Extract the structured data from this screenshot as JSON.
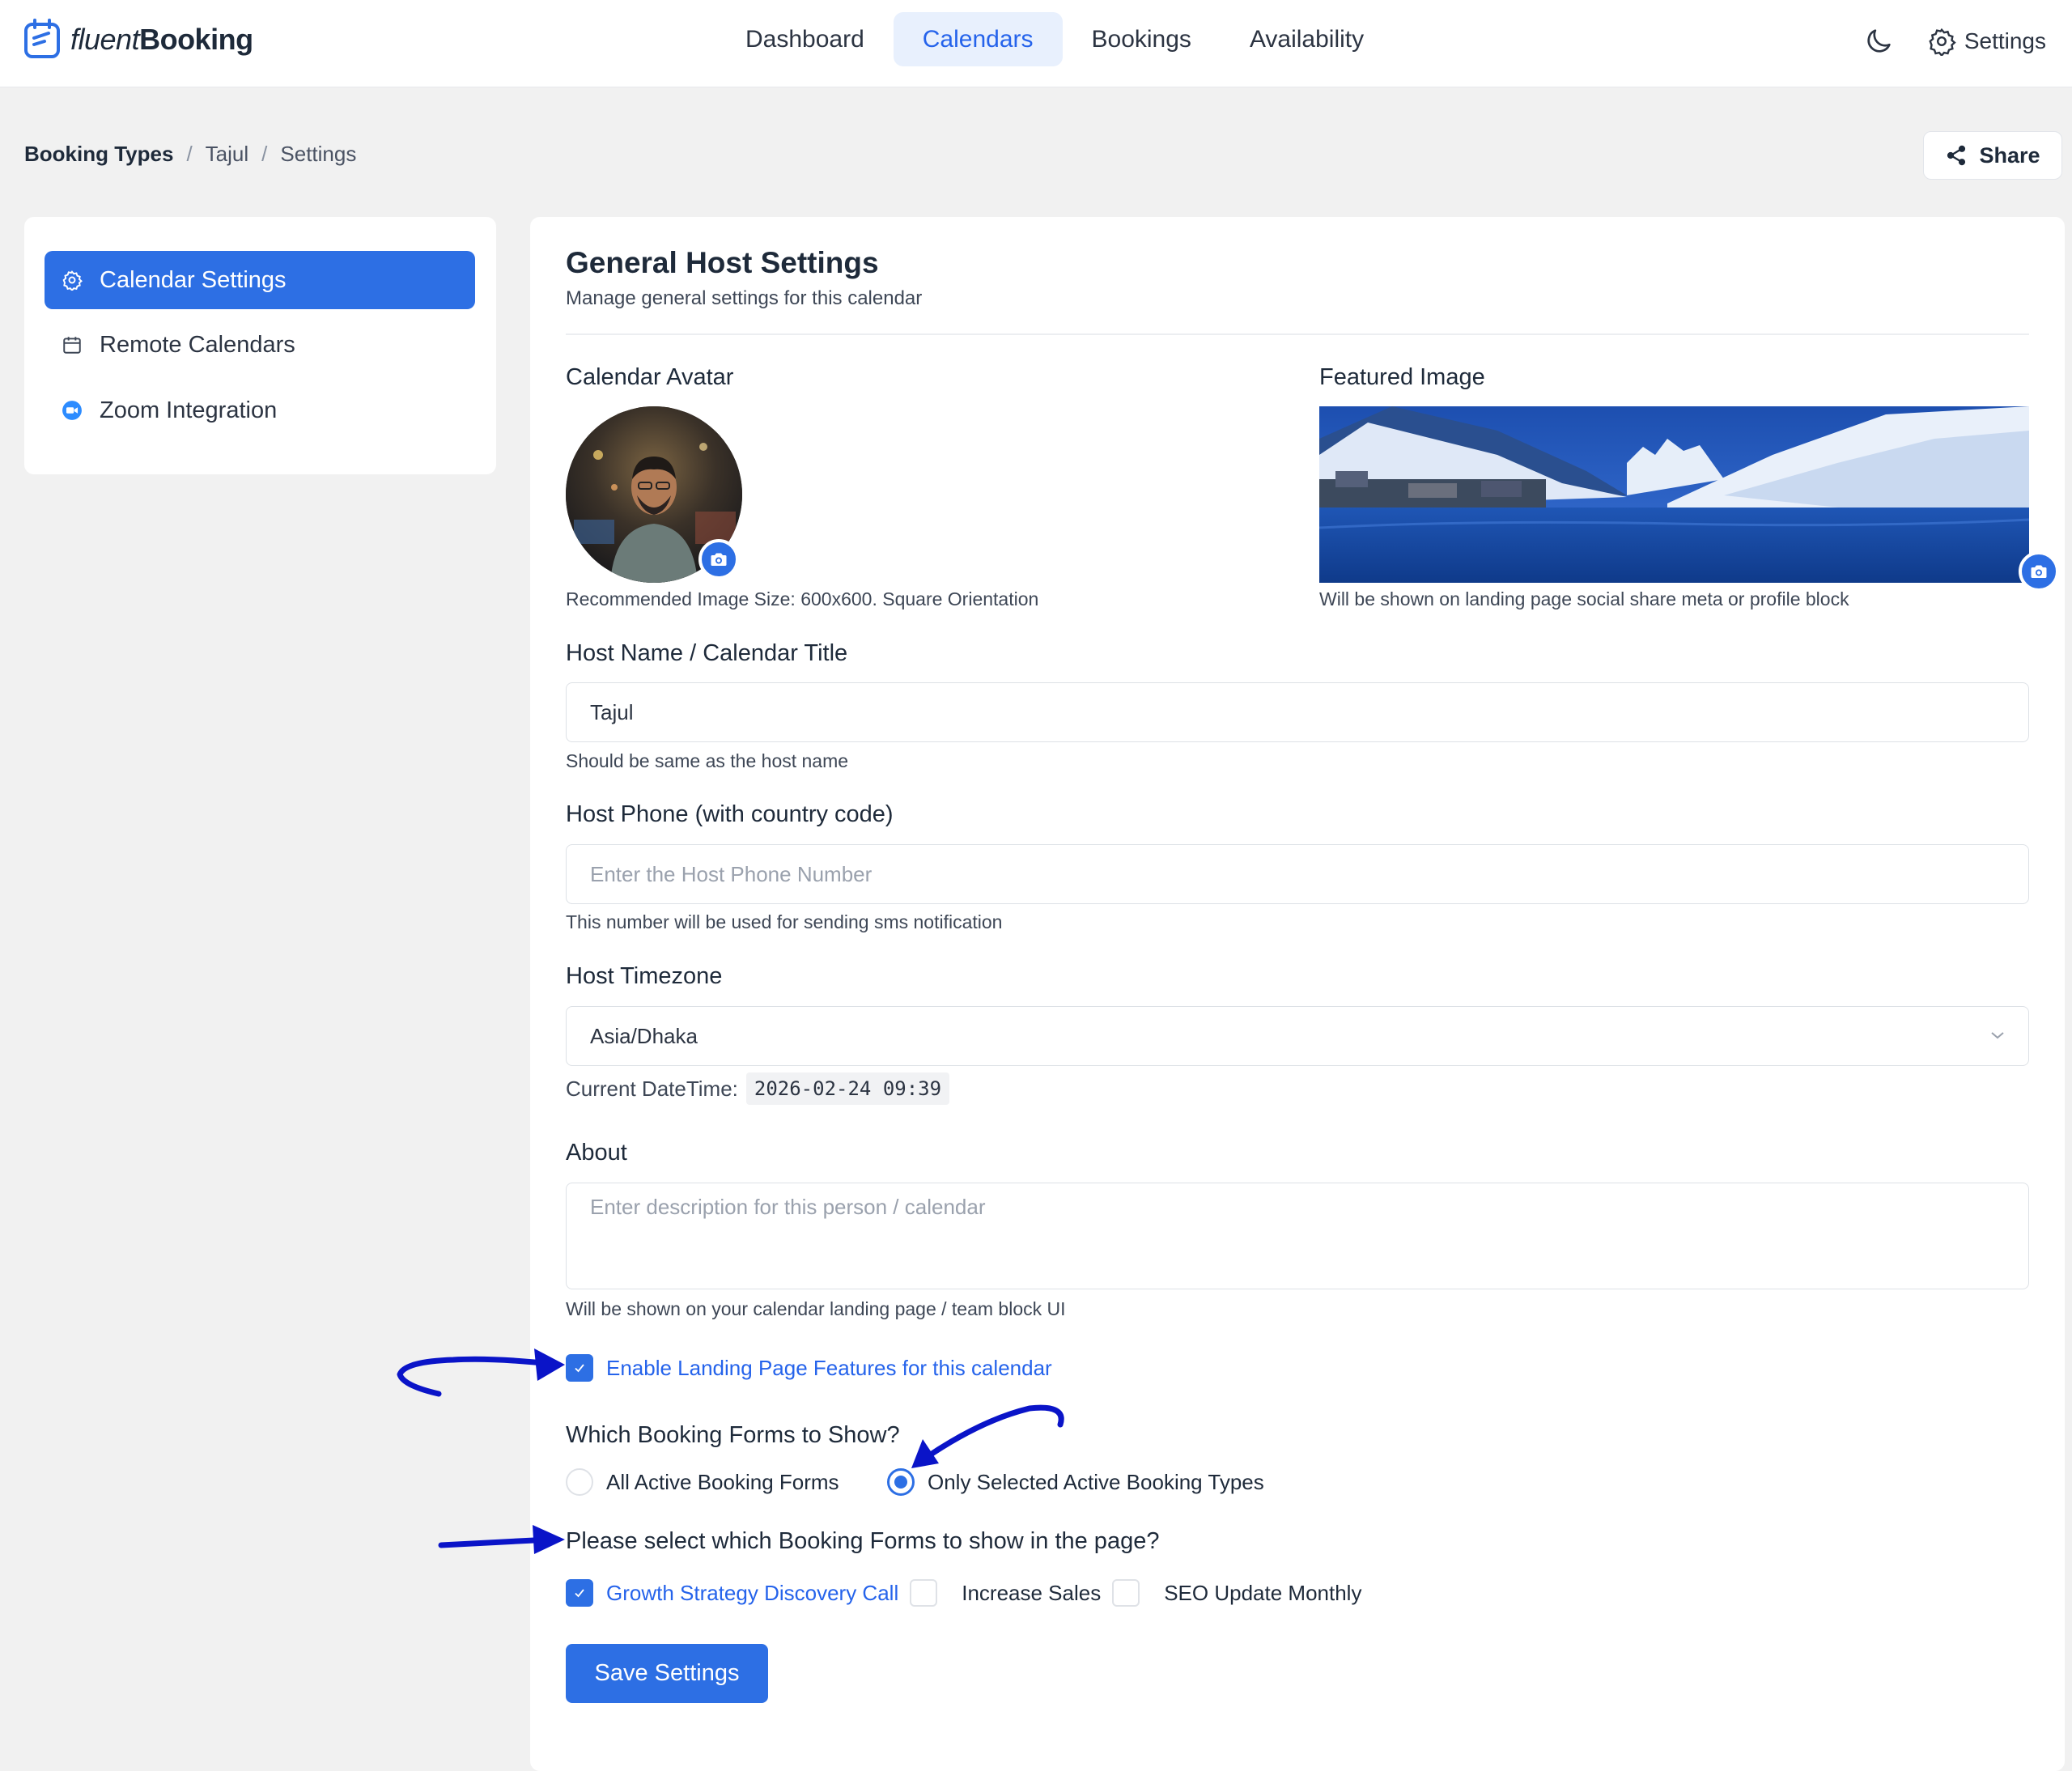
{
  "brand": {
    "name_light": "fluent",
    "name_bold": "Booking",
    "accent": "#2d6fe4"
  },
  "nav": {
    "items": [
      {
        "label": "Dashboard",
        "active": false
      },
      {
        "label": "Calendars",
        "active": true
      },
      {
        "label": "Bookings",
        "active": false
      },
      {
        "label": "Availability",
        "active": false
      }
    ],
    "settings_label": "Settings"
  },
  "breadcrumb": {
    "root": "Booking Types",
    "item1": "Tajul",
    "item2": "Settings"
  },
  "share_label": "Share",
  "sidebar": {
    "items": [
      {
        "label": "Calendar Settings",
        "icon": "gear-icon",
        "active": true
      },
      {
        "label": "Remote Calendars",
        "icon": "calendar-icon",
        "active": false
      },
      {
        "label": "Zoom Integration",
        "icon": "zoom-icon",
        "active": false
      }
    ]
  },
  "general": {
    "title": "General Host Settings",
    "subtitle": "Manage general settings for this calendar",
    "avatar_label": "Calendar Avatar",
    "avatar_help": "Recommended Image Size: 600x600. Square Orientation",
    "featured_label": "Featured Image",
    "featured_help": "Will be shown on landing page social share meta or profile block",
    "host_name_label": "Host Name / Calendar Title",
    "host_name_value": "Tajul",
    "host_name_help": "Should be same as the host name",
    "phone_label": "Host Phone (with country code)",
    "phone_placeholder": "Enter the Host Phone Number",
    "phone_help": "This number will be used for sending sms notification",
    "timezone_label": "Host Timezone",
    "timezone_value": "Asia/Dhaka",
    "current_dt_label": "Current DateTime:",
    "current_dt_value": "2026-02-24 09:39",
    "about_label": "About",
    "about_placeholder": "Enter description for this person / calendar",
    "about_help": "Will be shown on your calendar landing page / team block UI",
    "landing_checkbox_label": "Enable Landing Page Features for this calendar",
    "landing_checked": true,
    "forms_question": "Which Booking Forms to Show?",
    "radio_all": "All Active Booking Forms",
    "radio_selected": "Only Selected Active Booking Types",
    "radio_value": "selected",
    "select_forms_question": "Please select which Booking Forms to show in the page?",
    "forms": [
      {
        "label": "Growth Strategy Discovery Call",
        "checked": true
      },
      {
        "label": "Increase Sales",
        "checked": false
      },
      {
        "label": "SEO Update Monthly",
        "checked": false
      }
    ],
    "save_label": "Save Settings"
  }
}
